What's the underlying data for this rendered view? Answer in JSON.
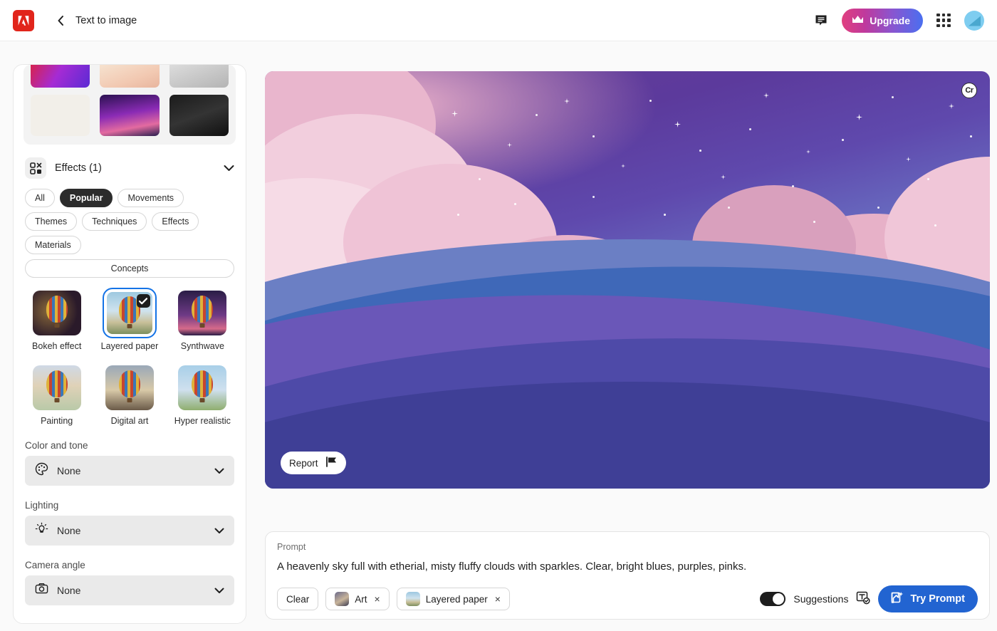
{
  "header": {
    "logo_name": "adobe-logo",
    "back_label": "‹",
    "title": "Text to image",
    "upgrade_label": "Upgrade",
    "feedback_icon": "speech-bubble-icon",
    "apps_icon": "app-grid-icon",
    "avatar_name": "user-avatar"
  },
  "sidebar": {
    "gallery_thumbs": [
      {
        "name": "thumb-neon-abstract"
      },
      {
        "name": "thumb-pastel-character"
      },
      {
        "name": "thumb-bw-portrait"
      },
      {
        "name": "thumb-sticker-sheet"
      },
      {
        "name": "thumb-purple-clouds"
      },
      {
        "name": "thumb-dark-portrait"
      }
    ],
    "effects_section": {
      "icon": "effects-grid-icon",
      "title": "Effects (1)",
      "chevron": "chevron-down-icon",
      "filters": [
        {
          "label": "All",
          "selected": false
        },
        {
          "label": "Popular",
          "selected": true
        },
        {
          "label": "Movements",
          "selected": false
        },
        {
          "label": "Themes",
          "selected": false
        },
        {
          "label": "Techniques",
          "selected": false
        },
        {
          "label": "Effects",
          "selected": false
        },
        {
          "label": "Materials",
          "selected": false
        },
        {
          "label": "Concepts",
          "selected": false
        }
      ],
      "items": [
        {
          "label": "Bokeh effect",
          "selected": false
        },
        {
          "label": "Layered paper",
          "selected": true
        },
        {
          "label": "Synthwave",
          "selected": false
        },
        {
          "label": "Painting",
          "selected": false
        },
        {
          "label": "Digital art",
          "selected": false
        },
        {
          "label": "Hyper realistic",
          "selected": false
        }
      ]
    },
    "dropdowns": [
      {
        "label": "Color and tone",
        "value": "None",
        "icon": "palette-icon"
      },
      {
        "label": "Lighting",
        "value": "None",
        "icon": "lightbulb-icon"
      },
      {
        "label": "Camera angle",
        "value": "None",
        "icon": "camera-icon"
      }
    ]
  },
  "canvas": {
    "credentials_badge": "Cr",
    "report_label": "Report",
    "report_icon": "flag-icon",
    "image_description": "Layered paper-cut heavenly sky with pink and purple clouds, sparkles, and flowing blue wave layers"
  },
  "prompt": {
    "caption": "Prompt",
    "text": "A heavenly sky full with etherial, misty fluffy clouds with sparkles. Clear, bright blues, purples, pinks.",
    "clear_label": "Clear",
    "tags": [
      {
        "label": "Art",
        "remove": "×"
      },
      {
        "label": "Layered paper",
        "remove": "×"
      }
    ],
    "suggestions_label": "Suggestions",
    "suggestions_icon": "text-check-icon",
    "suggestions_on": true,
    "try_label": "Try Prompt",
    "try_icon": "magic-image-icon"
  },
  "colors": {
    "accent_blue": "#2264d1",
    "selection_blue": "#1473e6",
    "adobe_red": "#e1251b",
    "dark": "#1d1d1d"
  }
}
